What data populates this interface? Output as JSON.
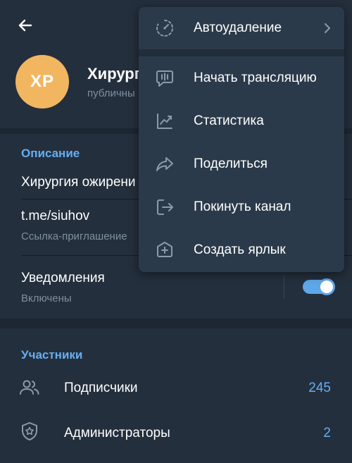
{
  "header": {
    "avatar_initials": "ХР",
    "channel_title": "Хирурги",
    "channel_subtitle": "публичны"
  },
  "info": {
    "section_title": "Описание",
    "description": "Хирургия ожирени",
    "link": "t.me/siuhov",
    "link_caption": "Ссылка-приглашение",
    "notifications_label": "Уведомления",
    "notifications_status": "Включены",
    "notifications_enabled": true
  },
  "members": {
    "section_title": "Участники",
    "rows": [
      {
        "label": "Подписчики",
        "count": "245",
        "icon": "people-icon"
      },
      {
        "label": "Администраторы",
        "count": "2",
        "icon": "admin-shield-icon"
      }
    ]
  },
  "menu": {
    "items": [
      {
        "label": "Автоудаление",
        "icon": "auto-delete-timer-icon",
        "has_submenu": true
      },
      {
        "label": "Начать трансляцию",
        "icon": "live-stream-icon"
      },
      {
        "label": "Статистика",
        "icon": "statistics-icon"
      },
      {
        "label": "Поделиться",
        "icon": "share-icon"
      },
      {
        "label": "Покинуть канал",
        "icon": "leave-icon"
      },
      {
        "label": "Создать ярлык",
        "icon": "add-shortcut-icon"
      }
    ]
  },
  "colors": {
    "background": "#1c2733",
    "card": "#242f3d",
    "menu": "#2b3a4a",
    "accent": "#66aef2",
    "avatar": "#f2b661",
    "secondary_text": "#7f8f9e"
  }
}
